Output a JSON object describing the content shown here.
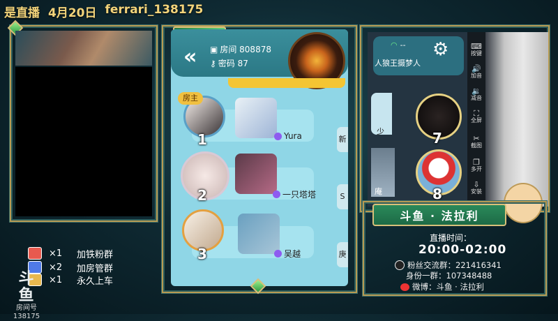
{
  "stream_title": {
    "live": "是直播",
    "date": "4月20日",
    "user": "ferrari_138175"
  },
  "perks": [
    {
      "count": "×1",
      "label": "加铁粉群",
      "color": "#e85a4f"
    },
    {
      "count": "×2",
      "label": "加房管群",
      "color": "#4f7ae8"
    },
    {
      "count": "×1",
      "label": "永久上车",
      "color": "#e8b84f"
    }
  ],
  "brand": {
    "logo": "斗鱼",
    "sub": "房间号",
    "room": "138175"
  },
  "game": {
    "room_label": "房间 808878",
    "password_label": "密码 87",
    "owner_badge": "房主",
    "seats": [
      {
        "num": "1",
        "name": "Yura",
        "side": "新"
      },
      {
        "num": "2",
        "name": "一只塔塔",
        "side": "S"
      },
      {
        "num": "3",
        "name": "吴越",
        "side": "庚"
      }
    ]
  },
  "right_game": {
    "wifi": "--",
    "mode": "人狼王摄梦人",
    "seats": [
      {
        "num": "7",
        "stub": "少"
      },
      {
        "num": "8",
        "stub": "庵"
      }
    ]
  },
  "toolbar": [
    "按键",
    "加音",
    "减音",
    "全屏",
    "截图",
    "多开",
    "安装"
  ],
  "info": {
    "banner": "斗鱼 · 法拉利",
    "time_label": "直播时间：",
    "time_value": "20:00-02:00",
    "fans_group": "粉丝交流群：221416341",
    "id_group": "身份一群：107348488",
    "weibo": "微博：斗鱼 · 法拉利"
  },
  "colors": {
    "gold": "#f3d47b",
    "frame": "#b79a52",
    "sky": "#8fd6e6",
    "banner": "#2a8a5a"
  }
}
